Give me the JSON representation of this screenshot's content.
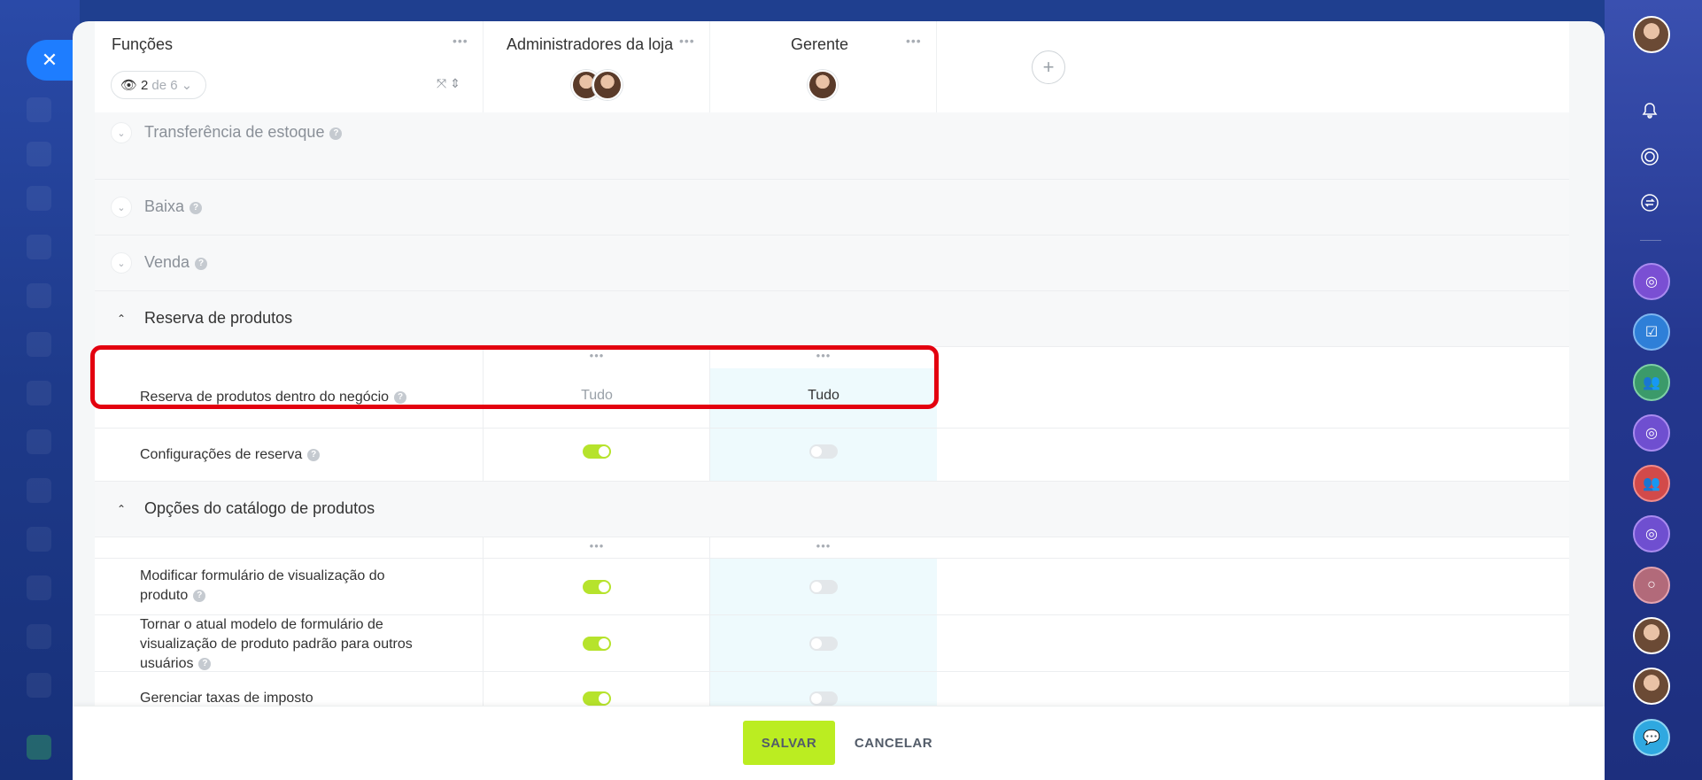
{
  "header": {
    "functions_title": "Funções",
    "role_filter": {
      "count": "2",
      "of_text": "de 6"
    },
    "columns": [
      {
        "title": "Administradores da loja"
      },
      {
        "title": "Gerente"
      }
    ]
  },
  "sections": {
    "transfer": "Transferência de estoque",
    "write_off": "Baixa",
    "sale": "Venda",
    "reservation": "Reserva de produtos",
    "catalog": "Opções do catálogo de produtos"
  },
  "permissions": {
    "reserve_in_deal": {
      "label": "Reserva de produtos dentro do negócio",
      "admin_value": "Tudo",
      "manager_value": "Tudo"
    },
    "reserve_settings": {
      "label": "Configurações de reserva",
      "admin_on": true,
      "manager_on": false
    },
    "modify_form": {
      "label": "Modificar formulário de visualização do produto",
      "admin_on": true,
      "manager_on": false
    },
    "default_form": {
      "label": "Tornar o atual modelo de formulário de visualização de produto padrão para outros usuários",
      "admin_on": true,
      "manager_on": false
    },
    "tax_rates": {
      "label": "Gerenciar taxas de imposto",
      "admin_on": true,
      "manager_on": false
    }
  },
  "footer": {
    "save_label": "SALVAR",
    "cancel_label": "CANCELAR"
  },
  "colors": {
    "accent_green": "#bbed21",
    "toggle_on": "#b6e32c",
    "highlight_red": "#e3000f",
    "close_blue": "#1e7dff"
  }
}
